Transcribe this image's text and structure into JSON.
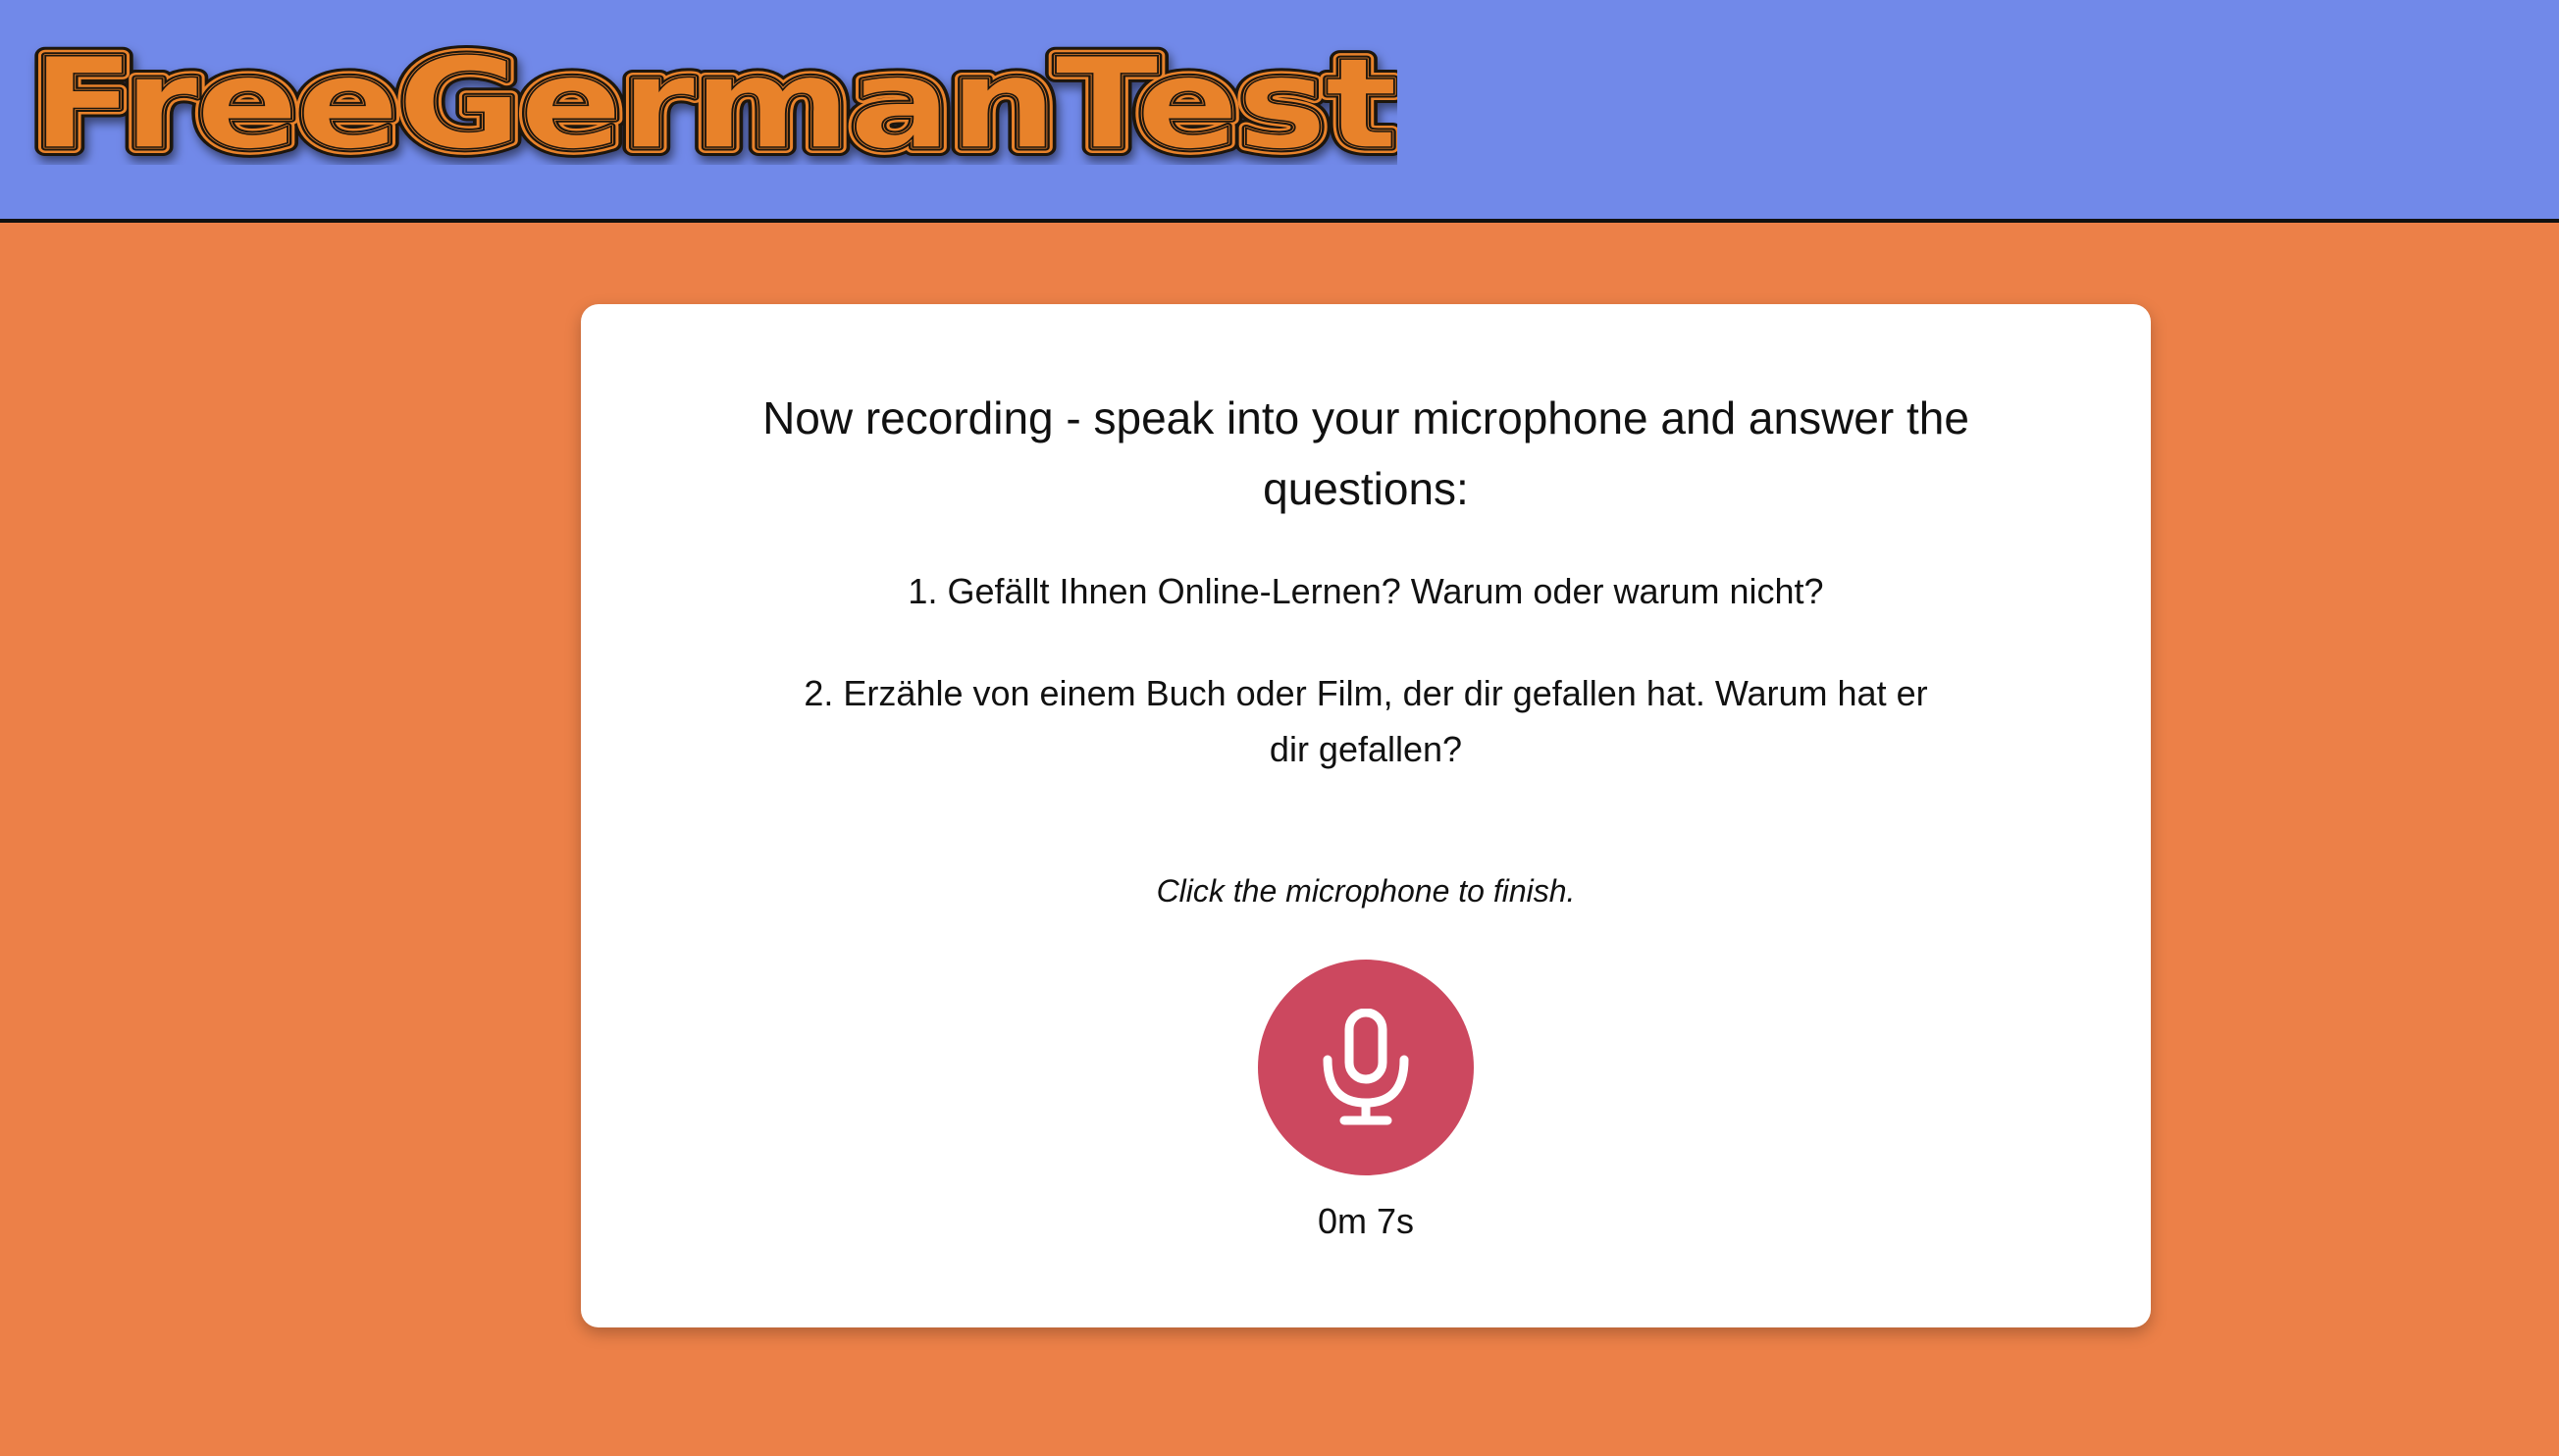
{
  "header": {
    "logo_text": "FreeGermanTest",
    "background_color": "#7189e9",
    "logo_fill_color": "#e8822c"
  },
  "recording": {
    "headline": "Now recording - speak into your microphone and answer the questions:",
    "questions": [
      "1. Gefällt Ihnen Online-Lernen? Warum oder warum nicht?",
      "2. Erzähle von einem Buch oder Film, der dir gefallen hat. Warum hat er dir gefallen?"
    ],
    "hint": "Click the microphone to finish.",
    "mic_icon": "microphone-icon",
    "mic_button_color": "#cc485f",
    "timer": "0m 7s"
  },
  "page": {
    "background_color": "#ec8048"
  }
}
